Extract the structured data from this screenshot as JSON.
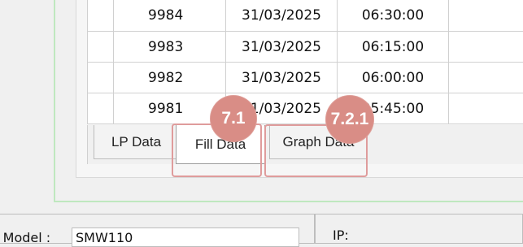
{
  "grid": {
    "rows": [
      {
        "id": "9984",
        "date": "31/03/2025",
        "time": "06:30:00"
      },
      {
        "id": "9983",
        "date": "31/03/2025",
        "time": "06:15:00"
      },
      {
        "id": "9982",
        "date": "31/03/2025",
        "time": "06:00:00"
      },
      {
        "id": "9981",
        "date": "31/03/2025",
        "time": "05:45:00"
      }
    ]
  },
  "tabs": {
    "lp_label": "LP Data",
    "fill_label": "Fill Data",
    "graph_label": "Graph Data"
  },
  "callouts": {
    "fill_badge": "7.1",
    "graph_badge": "7.2.1",
    "color": "#d98d86"
  },
  "bottom": {
    "model_label": "r Model :",
    "model_value": "SMW110",
    "ip_label": "IP:"
  },
  "colors": {
    "frame_border": "#bfe8bf",
    "callout_border": "#df9c9c"
  }
}
